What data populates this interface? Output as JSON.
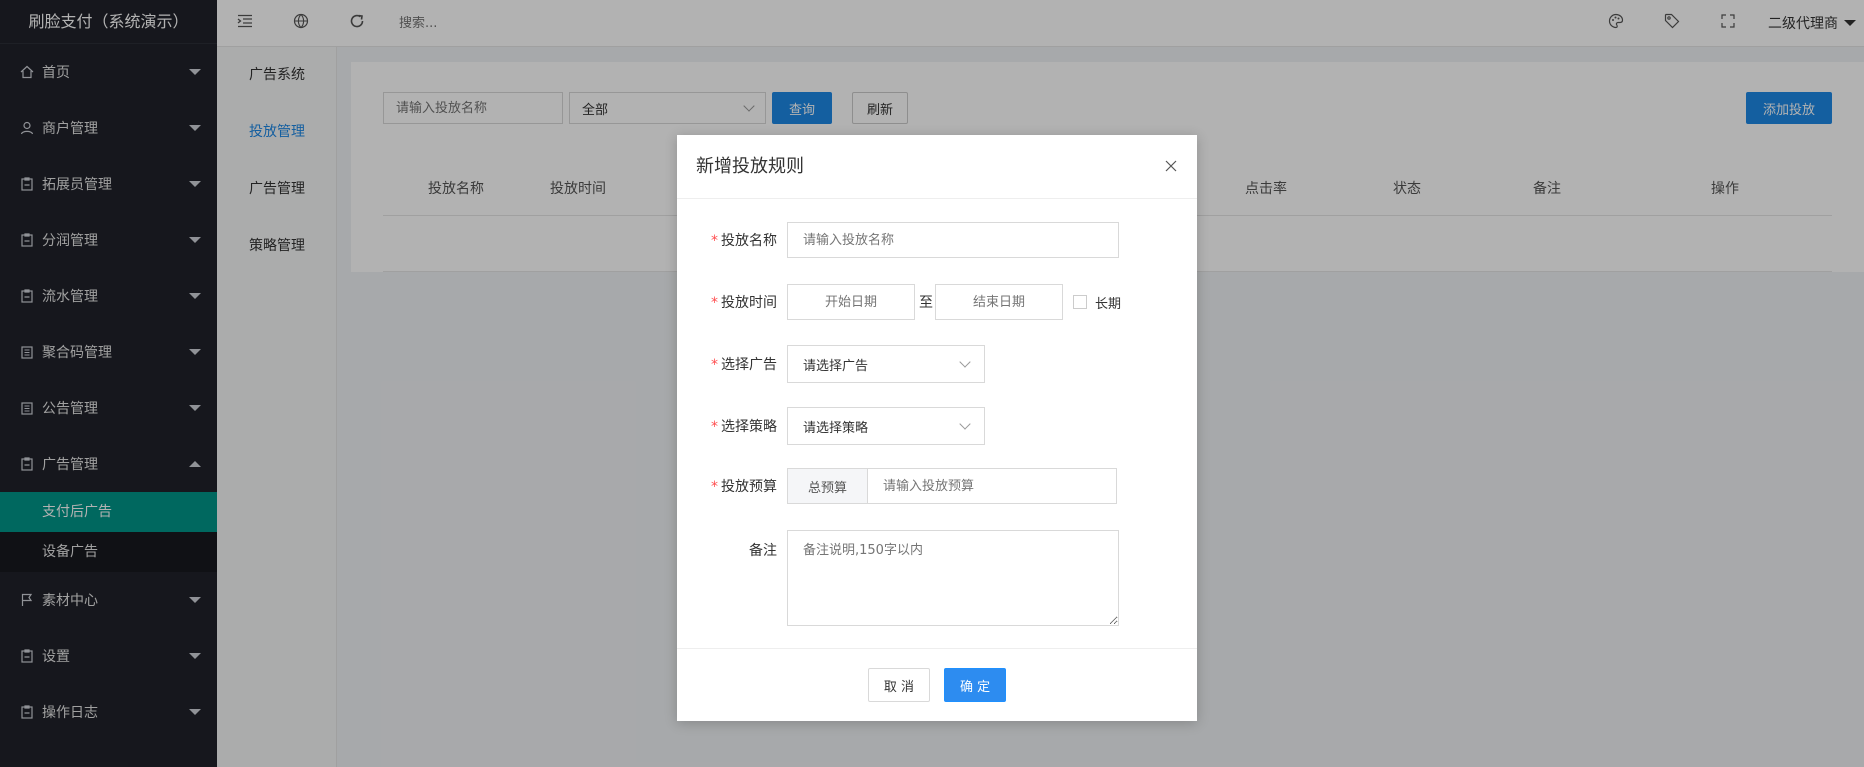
{
  "app": {
    "title": "刷脸支付（系统演示）"
  },
  "sidebar": {
    "items": [
      {
        "label": "首页",
        "icon": "home-icon"
      },
      {
        "label": "商户管理",
        "icon": "user-icon"
      },
      {
        "label": "拓展员管理",
        "icon": "clipboard-icon"
      },
      {
        "label": "分润管理",
        "icon": "clipboard-icon"
      },
      {
        "label": "流水管理",
        "icon": "clipboard-icon"
      },
      {
        "label": "聚合码管理",
        "icon": "list-icon"
      },
      {
        "label": "公告管理",
        "icon": "list-icon"
      },
      {
        "label": "广告管理",
        "icon": "clipboard-icon",
        "open": true
      },
      {
        "label": "素材中心",
        "icon": "flag-icon"
      },
      {
        "label": "设置",
        "icon": "clipboard-icon"
      },
      {
        "label": "操作日志",
        "icon": "clipboard-icon"
      }
    ],
    "sub_items": [
      {
        "label": "支付后广告",
        "active": true
      },
      {
        "label": "设备广告",
        "active": false
      }
    ]
  },
  "header": {
    "search_placeholder": "搜索...",
    "user": "二级代理商"
  },
  "subnav": {
    "items": [
      {
        "label": "广告系统"
      },
      {
        "label": "投放管理",
        "active": true
      },
      {
        "label": "广告管理"
      },
      {
        "label": "策略管理"
      }
    ]
  },
  "main": {
    "search_placeholder": "请输入投放名称",
    "filter_value": "全部",
    "query_label": "查询",
    "refresh_label": "刷新",
    "add_label": "添加投放",
    "columns": [
      "投放名称",
      "投放时间",
      "点击率",
      "状态",
      "备注",
      "操作"
    ]
  },
  "modal": {
    "title": "新增投放规则",
    "fields": {
      "name_label": "投放名称",
      "name_placeholder": "请输入投放名称",
      "time_label": "投放时间",
      "start_placeholder": "开始日期",
      "to_text": "至",
      "end_placeholder": "结束日期",
      "longterm_label": "长期",
      "ad_label": "选择广告",
      "ad_value": "请选择广告",
      "strategy_label": "选择策略",
      "strategy_value": "请选择策略",
      "budget_label": "投放预算",
      "budget_prefix": "总预算",
      "budget_placeholder": "请输入投放预算",
      "remark_label": "备注",
      "remark_placeholder": "备注说明,150字以内"
    },
    "cancel_label": "取 消",
    "ok_label": "确 定"
  },
  "colors": {
    "sidebar_bg": "#20222a",
    "active_green": "#009688",
    "primary_blue": "#1e88e5",
    "required_red": "#ff4d4f"
  }
}
